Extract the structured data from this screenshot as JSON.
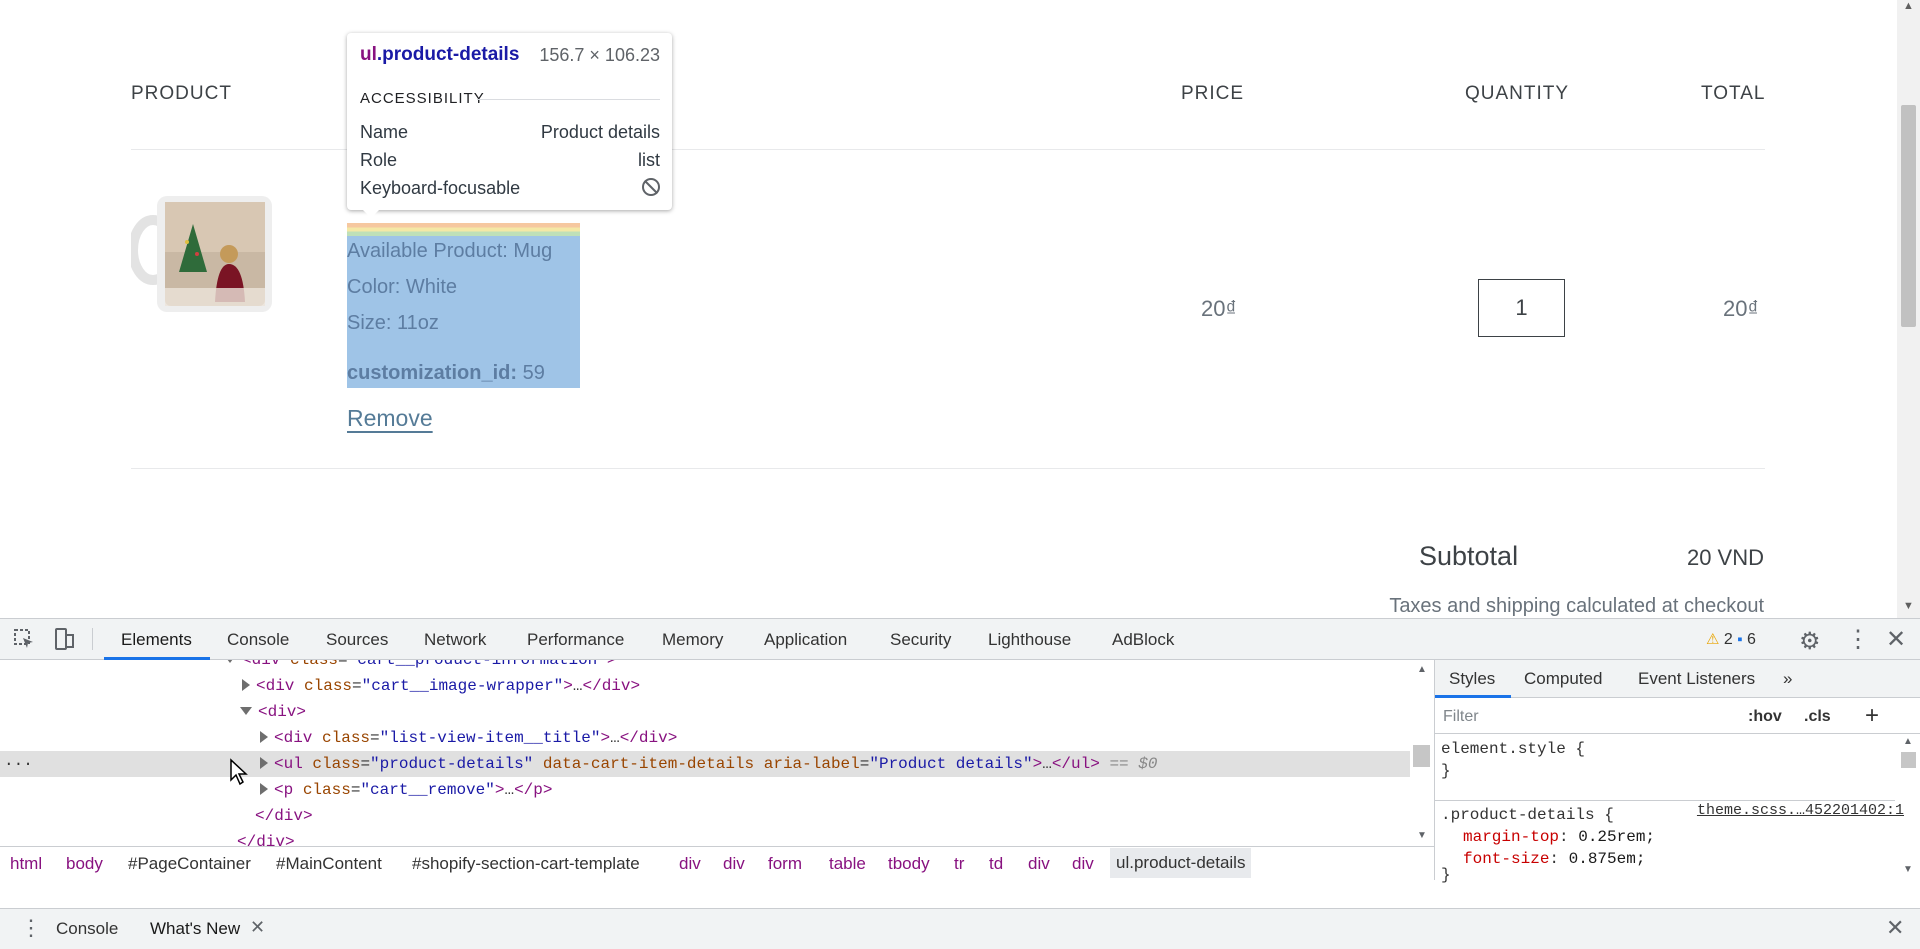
{
  "cart": {
    "headers": {
      "product": "PRODUCT",
      "price": "PRICE",
      "quantity": "QUANTITY",
      "total": "TOTAL"
    },
    "item": {
      "details": [
        {
          "label": "",
          "value": "Available Product: Mug"
        },
        {
          "label": "",
          "value": "Color: White"
        },
        {
          "label": "",
          "value": "Size: 11oz"
        }
      ],
      "customization_label": "customization_id:",
      "customization_value": "59",
      "remove": "Remove",
      "price": "20₫",
      "quantity": "1",
      "total": "20₫"
    },
    "subtotal_label": "Subtotal",
    "subtotal_value": "20 VND",
    "taxes_note": "Taxes and shipping calculated at checkout"
  },
  "tooltip": {
    "tag": "ul",
    "cls": ".product-details",
    "dims": "156.7 × 106.23",
    "section": "ACCESSIBILITY",
    "rows": [
      {
        "k": "Name",
        "v": "Product details"
      },
      {
        "k": "Role",
        "v": "list"
      },
      {
        "k": "Keyboard-focusable",
        "v": ""
      }
    ]
  },
  "devtools": {
    "tabs": [
      "Elements",
      "Console",
      "Sources",
      "Network",
      "Performance",
      "Memory",
      "Application",
      "Security",
      "Lighthouse",
      "AdBlock"
    ],
    "warn_count": "2",
    "msg_count": "6",
    "breadcrumbs": [
      "html",
      "body",
      "#PageContainer",
      "#MainContent",
      "#shopify-section-cart-template",
      "div",
      "div",
      "form",
      "table",
      "tbody",
      "tr",
      "td",
      "div",
      "div",
      "ul.product-details"
    ],
    "styles_tabs": [
      "Styles",
      "Computed",
      "Event Listeners",
      "»"
    ],
    "filter_placeholder": "Filter",
    "hov": ":hov",
    "cls": ".cls",
    "element_style": "element.style {",
    "rule_selector": ".product-details {",
    "rule_source": "theme.scss.…452201402:1",
    "rule_props": [
      {
        "p": "margin-top",
        "v": "0.25rem;"
      },
      {
        "p": "font-size",
        "v": "0.875em;"
      }
    ],
    "drawer_tabs": [
      "Console",
      "What's New"
    ]
  },
  "colors": {
    "accent": "#1a73e8",
    "selection": "#9fc4e7",
    "tag": "#881280"
  }
}
